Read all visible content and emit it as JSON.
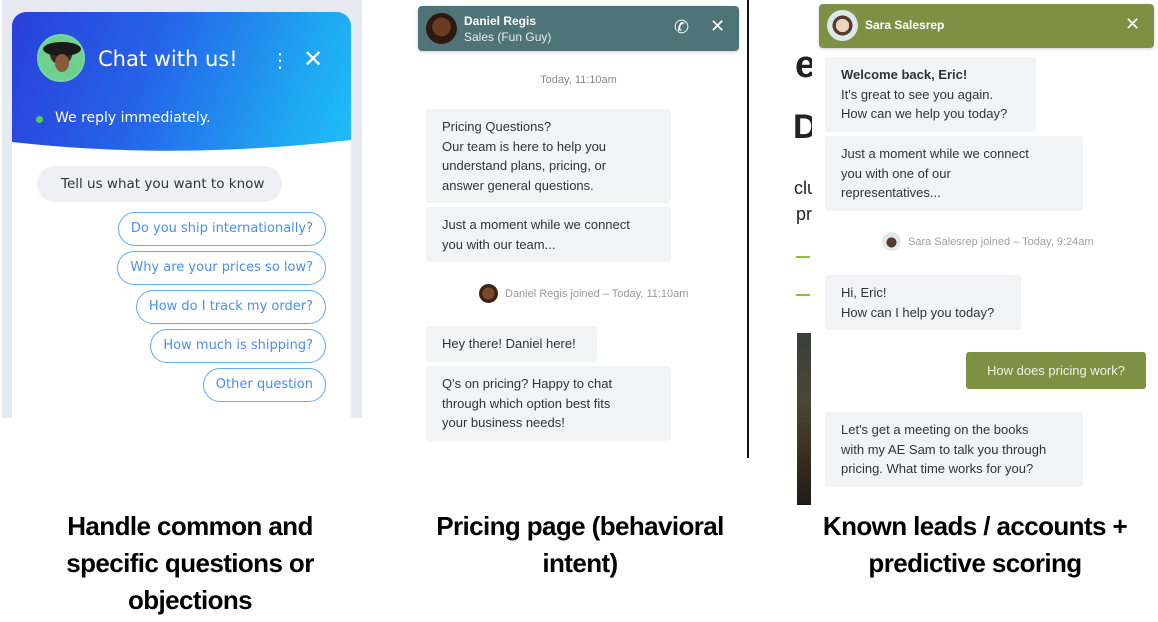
{
  "panel_common": {
    "widget_title": "Chat with us!",
    "status_text": "We reply immediately.",
    "prompt_text": "Tell us what you want to know",
    "menu_icon": "vertical-ellipsis-icon",
    "close_glyph": "✕",
    "options": [
      "Do you ship internationally?",
      "Why are your prices so low?",
      "How do I track my order?",
      "How much is shipping?",
      "Other question"
    ],
    "colors": {
      "gradient_start": "#2a3fd9",
      "gradient_end": "#1ec0f8",
      "option_border": "#62aaf5",
      "status_dot": "#5ac85a"
    }
  },
  "panel_pricing": {
    "agent_name": "Daniel Regis",
    "agent_role": "Sales (Fun Guy)",
    "phone_glyph": "✆",
    "close_glyph": "✕",
    "timestamp": "Today, 11:10am",
    "messages_before": [
      "Pricing Questions?\nOur team is here to help you\nunderstand plans, pricing, or\nanswer general questions.",
      "Just a moment while we connect\nyou with our team..."
    ],
    "joined_text": "Daniel Regis joined – Today, 11:10am",
    "messages_after": [
      "Hey there! Daniel here!",
      "Q's on pricing? Happy to chat\nthrough which option best fits\nyour business needs!"
    ],
    "colors": {
      "header": "#4e7379",
      "bubble": "#f2f3f5"
    }
  },
  "panel_known_leads": {
    "agent_name": "Sara Salesrep",
    "close_glyph": "✕",
    "welcome_bold": "Welcome back, Eric!",
    "welcome_rest": "It's great to see you again.\nHow can we help you today?",
    "connect_message": "Just a moment while we connect\nyou with one of our\nrepresentatives...",
    "joined_text": "Sara Salesrep joined – Today, 9:24am",
    "agent_greeting": "Hi, Eric!\nHow can I help you today?",
    "user_message": "How does pricing work?",
    "agent_reply": "Let's get a meeting on the books\nwith my AE Sam to talk you through\npricing. What time works for you?",
    "background_fragments": [
      "e",
      "D",
      "clu",
      "pro"
    ],
    "colors": {
      "header": "#7e9044",
      "user_bubble": "#7e9044",
      "accent_line": "#8bbf3c"
    }
  },
  "captions": [
    "Handle common and\nspecific questions or\nobjections",
    "Pricing page (behavioral\nintent)",
    "Known leads / accounts +\npredictive scoring"
  ]
}
